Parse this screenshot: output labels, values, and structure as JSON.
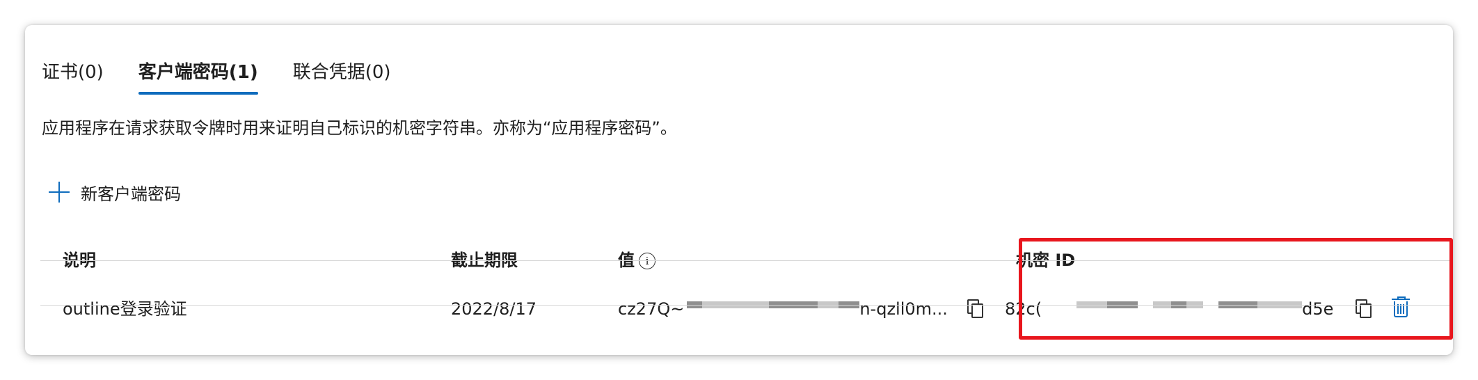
{
  "tabs": [
    {
      "label": "证书(0)",
      "active": false
    },
    {
      "label": "客户端密码(1)",
      "active": true
    },
    {
      "label": "联合凭据(0)",
      "active": false
    }
  ],
  "description": "应用程序在请求获取令牌时用来证明自己标识的机密字符串。亦称为“应用程序密码”。",
  "new_button": {
    "label": "新客户端密码",
    "icon": "plus-icon"
  },
  "table": {
    "headers": {
      "description": "说明",
      "expires": "截止期限",
      "value": "值",
      "value_info_icon": "i",
      "secret_id": "机密 ID"
    },
    "rows": [
      {
        "description": "outline登录验证",
        "expires": "2022/8/17",
        "value_prefix": "cz27Q~",
        "value_suffix": "n-qzll0m...",
        "secret_id_prefix": "82c(",
        "secret_id_suffix": "d5e"
      }
    ]
  },
  "colors": {
    "accent": "#0f6cbd",
    "highlight": "#e8161d"
  }
}
